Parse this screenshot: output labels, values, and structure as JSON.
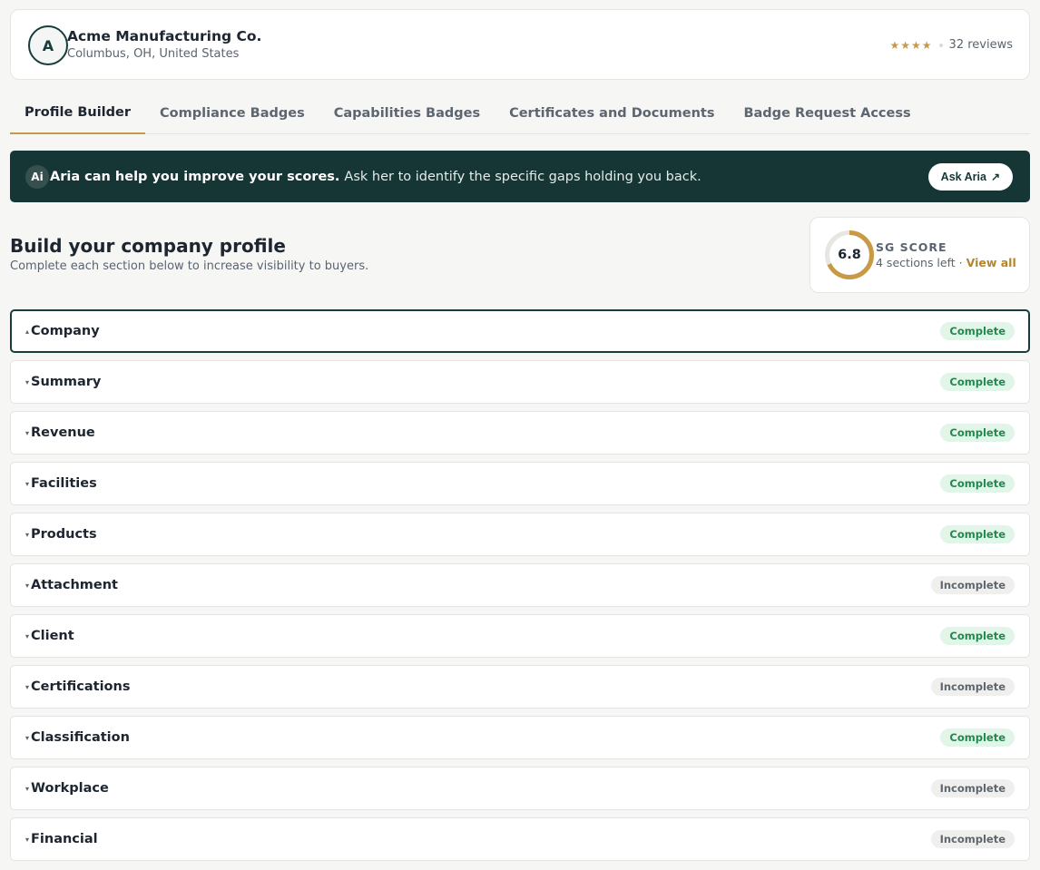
{
  "company": {
    "avatar_initial": "A",
    "name": "Acme Manufacturing Co.",
    "location": "Columbus, OH, United States",
    "stars": "★★★★",
    "reviews": "32 reviews"
  },
  "tabs": [
    {
      "label": "Profile Builder",
      "active": true
    },
    {
      "label": "Compliance Badges",
      "active": false
    },
    {
      "label": "Capabilities Badges",
      "active": false
    },
    {
      "label": "Certificates and Documents",
      "active": false
    },
    {
      "label": "Badge Request Access",
      "active": false
    }
  ],
  "aria_banner": {
    "badge": "Ai",
    "headline": "Aria can help you improve your scores.",
    "message": "Ask her to identify the specific gaps holding you back.",
    "button_label": "Ask Aria",
    "button_icon": "↗"
  },
  "profile": {
    "title": "Build your company profile",
    "subtitle": "Complete each section below to increase visibility to buyers."
  },
  "score": {
    "value": "6.8",
    "progress_fraction": 0.68,
    "label": "SG SCORE",
    "sections_left": "4 sections left ·",
    "view_all": "View all"
  },
  "colors": {
    "accent_gold": "#c89a45",
    "dark_teal": "#153635",
    "complete_bg": "#e1f5e8",
    "complete_text": "#218a4f",
    "incomplete_bg": "#eff0ee",
    "incomplete_text": "#5e666e"
  },
  "sections": [
    {
      "name": "Company",
      "status": "Complete",
      "open": true,
      "chevron": "▴"
    },
    {
      "name": "Summary",
      "status": "Complete",
      "open": false,
      "chevron": "▾"
    },
    {
      "name": "Revenue",
      "status": "Complete",
      "open": false,
      "chevron": "▾"
    },
    {
      "name": "Facilities",
      "status": "Complete",
      "open": false,
      "chevron": "▾"
    },
    {
      "name": "Products",
      "status": "Complete",
      "open": false,
      "chevron": "▾"
    },
    {
      "name": "Attachment",
      "status": "Incomplete",
      "open": false,
      "chevron": "▾"
    },
    {
      "name": "Client",
      "status": "Complete",
      "open": false,
      "chevron": "▾"
    },
    {
      "name": "Certifications",
      "status": "Incomplete",
      "open": false,
      "chevron": "▾"
    },
    {
      "name": "Classification",
      "status": "Complete",
      "open": false,
      "chevron": "▾"
    },
    {
      "name": "Workplace",
      "status": "Incomplete",
      "open": false,
      "chevron": "▾"
    },
    {
      "name": "Financial",
      "status": "Incomplete",
      "open": false,
      "chevron": "▾"
    }
  ]
}
